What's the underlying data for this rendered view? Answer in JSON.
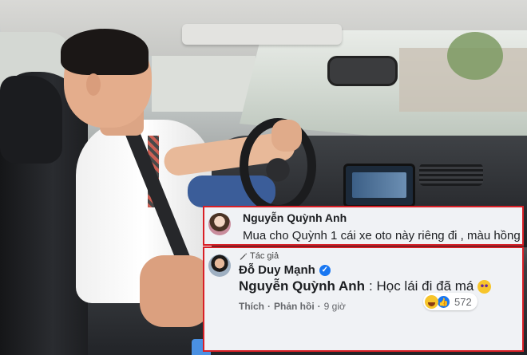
{
  "comments": [
    {
      "author": "Nguyễn Quỳnh Anh",
      "text": "Mua cho Quỳnh 1 cái xe oto này riêng đi , màu hồng"
    }
  ],
  "reply": {
    "author_tag": "Tác giả",
    "author": "Đỗ Duy Mạnh",
    "mention": "Nguyễn Quỳnh Anh",
    "text": ": Học lái đi đã má",
    "reaction_count": "572",
    "actions": {
      "like": "Thích",
      "reply": "Phản hồi",
      "separator": "·",
      "time": "9 giờ"
    }
  },
  "colors": {
    "highlight_border": "#d91f26",
    "comment_bg": "#f0f2f5",
    "verified": "#1877f2"
  },
  "icons": [
    "pencil-icon",
    "verified-icon",
    "star-struck-emoji-icon",
    "haha-reaction-icon",
    "like-reaction-icon"
  ]
}
